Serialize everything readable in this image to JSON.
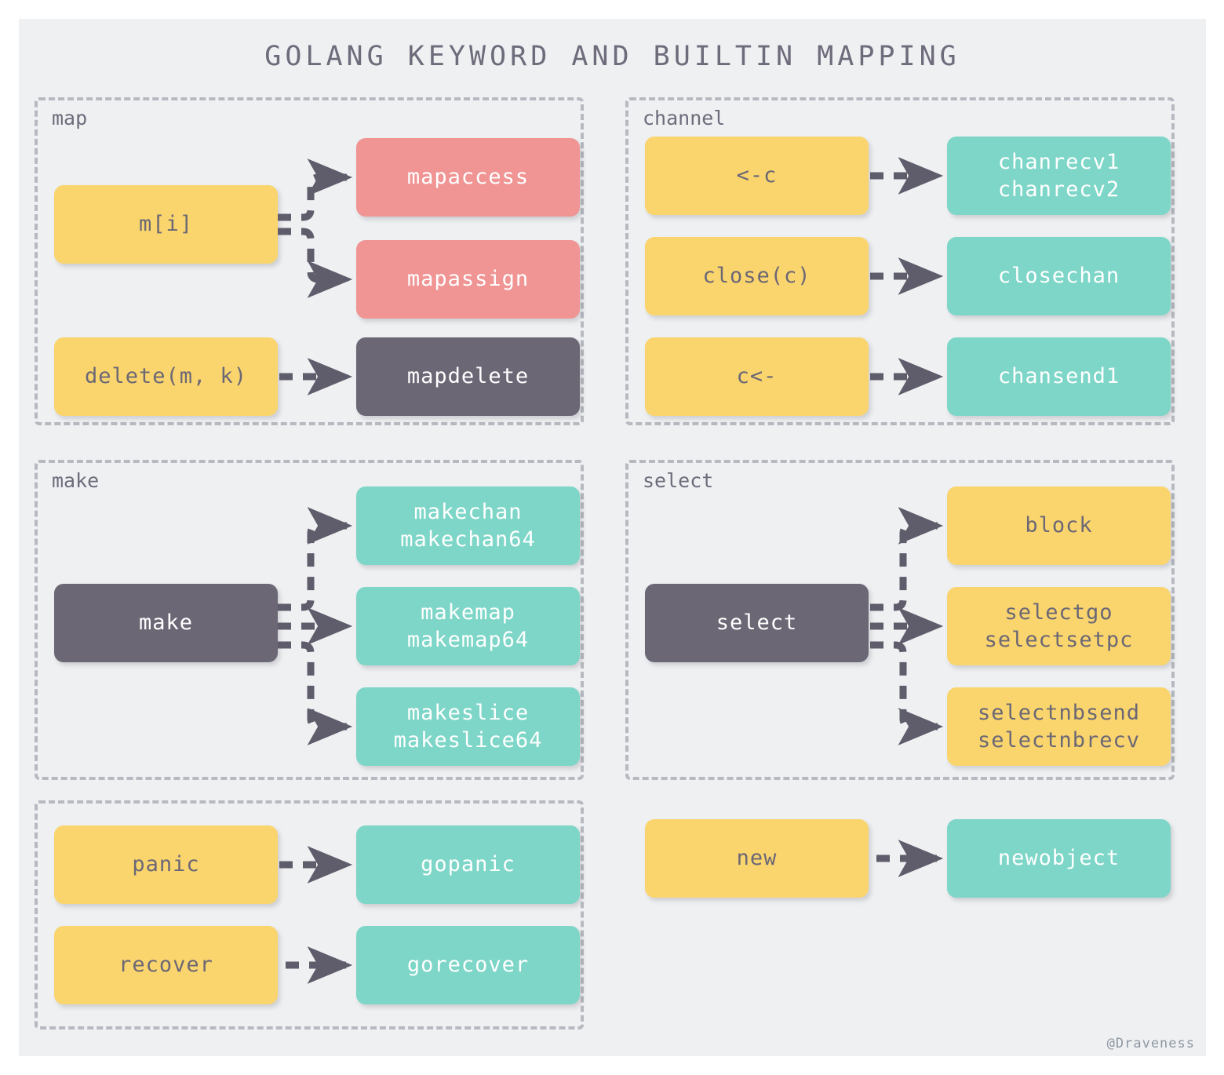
{
  "page": {
    "title": "GOLANG KEYWORD AND BUILTIN MAPPING",
    "watermark": "@Draveness",
    "colors": {
      "background": "#eef0f2",
      "yellow": "#fad56e",
      "teal": "#7dd6c7",
      "pink": "#f09494",
      "dark": "#6b6775",
      "arrow": "#5f5c6b",
      "panel_border": "#b6b9bf",
      "title_text": "#6e6b7b"
    }
  },
  "groups": [
    {
      "key": "map",
      "title": "map",
      "sources": [
        {
          "label": "m[i]",
          "color": "yellow"
        },
        {
          "label": "delete(m, k)",
          "color": "yellow"
        }
      ],
      "targets": [
        {
          "label": "mapaccess",
          "color": "pink"
        },
        {
          "label": "mapassign",
          "color": "pink"
        },
        {
          "label": "mapdelete",
          "color": "dark"
        }
      ],
      "edges": [
        {
          "from": "m[i]",
          "to": "mapaccess",
          "style": "elbow-up"
        },
        {
          "from": "m[i]",
          "to": "mapassign",
          "style": "elbow-down"
        },
        {
          "from": "delete(m, k)",
          "to": "mapdelete",
          "style": "straight"
        }
      ]
    },
    {
      "key": "channel",
      "title": "channel",
      "sources": [
        {
          "label": "<-c",
          "color": "yellow"
        },
        {
          "label": "close(c)",
          "color": "yellow"
        },
        {
          "label": "c<-",
          "color": "yellow"
        }
      ],
      "targets": [
        {
          "label": "chanrecv1\nchanrecv2",
          "color": "teal"
        },
        {
          "label": "closechan",
          "color": "teal"
        },
        {
          "label": "chansend1",
          "color": "teal"
        }
      ],
      "edges": [
        {
          "from": "<-c",
          "to": "chanrecv1/chanrecv2",
          "style": "straight"
        },
        {
          "from": "close(c)",
          "to": "closechan",
          "style": "straight"
        },
        {
          "from": "c<-",
          "to": "chansend1",
          "style": "straight"
        }
      ]
    },
    {
      "key": "make",
      "title": "make",
      "sources": [
        {
          "label": "make",
          "color": "dark"
        }
      ],
      "targets": [
        {
          "label": "makechan\nmakechan64",
          "color": "teal"
        },
        {
          "label": "makemap\nmakemap64",
          "color": "teal"
        },
        {
          "label": "makeslice\nmakeslice64",
          "color": "teal"
        }
      ],
      "edges": [
        {
          "from": "make",
          "to": "makechan/makechan64",
          "style": "elbow-up"
        },
        {
          "from": "make",
          "to": "makemap/makemap64",
          "style": "straight"
        },
        {
          "from": "make",
          "to": "makeslice/makeslice64",
          "style": "elbow-down"
        }
      ]
    },
    {
      "key": "select",
      "title": "select",
      "sources": [
        {
          "label": "select",
          "color": "dark"
        }
      ],
      "targets": [
        {
          "label": "block",
          "color": "yellow"
        },
        {
          "label": "selectgo\nselectsetpc",
          "color": "yellow"
        },
        {
          "label": "selectnbsend\nselectnbrecv",
          "color": "yellow"
        }
      ],
      "edges": [
        {
          "from": "select",
          "to": "block",
          "style": "elbow-up"
        },
        {
          "from": "select",
          "to": "selectgo/selectsetpc",
          "style": "straight"
        },
        {
          "from": "select",
          "to": "selectnbsend/selectnbrecv",
          "style": "elbow-down"
        }
      ]
    },
    {
      "key": "panic",
      "title": "",
      "sources": [
        {
          "label": "panic",
          "color": "yellow"
        },
        {
          "label": "recover",
          "color": "yellow"
        }
      ],
      "targets": [
        {
          "label": "gopanic",
          "color": "teal"
        },
        {
          "label": "gorecover",
          "color": "teal"
        }
      ],
      "edges": [
        {
          "from": "panic",
          "to": "gopanic",
          "style": "straight"
        },
        {
          "from": "recover",
          "to": "gorecover",
          "style": "straight"
        }
      ]
    },
    {
      "key": "new",
      "title": "",
      "sources": [
        {
          "label": "new",
          "color": "yellow"
        }
      ],
      "targets": [
        {
          "label": "newobject",
          "color": "teal"
        }
      ],
      "edges": [
        {
          "from": "new",
          "to": "newobject",
          "style": "straight"
        }
      ]
    }
  ]
}
